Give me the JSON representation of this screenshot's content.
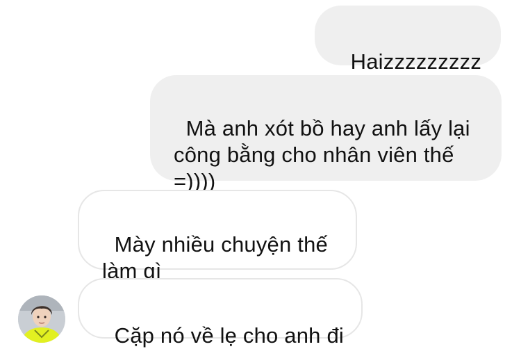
{
  "messages": [
    {
      "sender": "self",
      "text": "Haizzzzzzzzz"
    },
    {
      "sender": "self",
      "text": "Mà anh xót bồ hay anh lấy lại\ncông bằng cho nhân viên thế\n=))))"
    },
    {
      "sender": "other",
      "text": "Mày nhiều chuyện thế\nlàm gì"
    },
    {
      "sender": "other",
      "text": "Cặp nó về lẹ cho anh đi"
    }
  ],
  "avatar": {
    "icon": "person-photo-icon",
    "shirt_color": "#e2f021"
  },
  "colors": {
    "sent_bubble": "#efefef",
    "received_border": "#e6e6e6",
    "text": "#111111"
  }
}
